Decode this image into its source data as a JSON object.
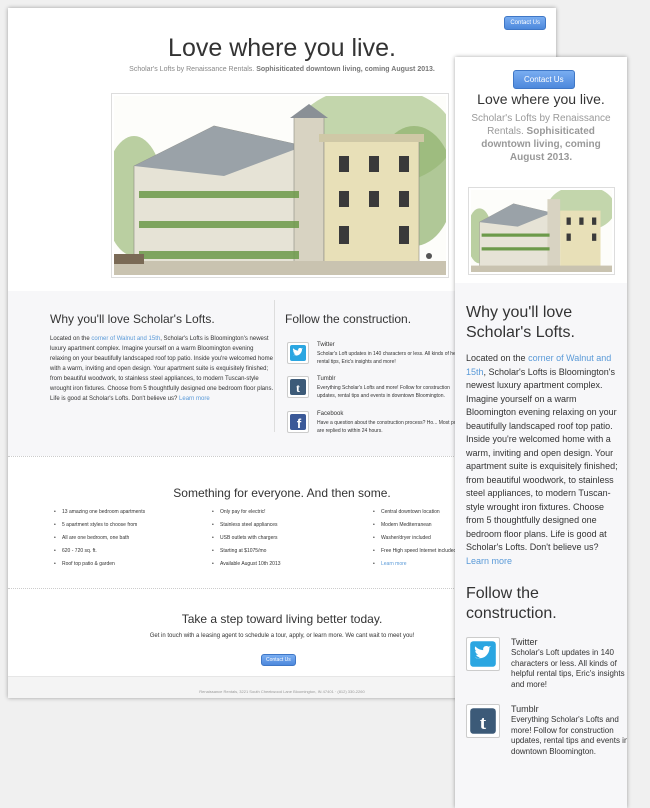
{
  "header": {
    "contact_label": "Contact Us",
    "title": "Love where you live.",
    "subtitle_plain": "Scholar's Lofts by Renaissance Rentals.",
    "subtitle_bold": "Sophisiticated downtown living, coming August 2013."
  },
  "why": {
    "heading_desktop": "Why you'll love Scholar's Lofts.",
    "heading_mobile": "Why you'll love Scholar's Lofts.",
    "lead": "Located on the",
    "link": "corner of Walnut and 15th",
    "body": ", Scholar's Lofts is Bloomington's newest luxury apartment complex. Imagine yourself on a warm Bloomington evening relaxing on your beautifully landscaped roof top patio. Inside you're welcomed home with a warm, inviting and open design. Your apartment suite is exquisitely finished; from beautiful woodwork, to stainless steel appliances, to modern Tuscan-style wrought iron fixtures. Choose from 5 thoughtfully designed one bedroom floor plans. Life is good at Scholar's Lofts. Don't believe us?",
    "more": "Learn more"
  },
  "follow": {
    "heading": "Follow the construction.",
    "items": [
      {
        "icon": "twitter-icon",
        "name": "Twitter",
        "desc": "Scholar's Loft updates in 140 characters or less. All kinds of helpful rental tips, Eric's insights and more!"
      },
      {
        "icon": "tumblr-icon",
        "name": "Tumblr",
        "desc": "Everything Scholar's Lofts and more! Follow for construction updates, rental tips and events in downtown Bloomington."
      },
      {
        "icon": "facebook-icon",
        "name": "Facebook",
        "desc": "Have a question about the construction process? Ho... Most posts are replied to within 24 hours."
      }
    ]
  },
  "features": {
    "heading": "Something for everyone. And then some.",
    "col1": [
      "13 amazing one bedroom apartments",
      "5 apartment styles to choose from",
      "All are one bedroom, one bath",
      "620 - 720 sq. ft.",
      "Roof top patio & garden"
    ],
    "col2": [
      "Only pay for electric!",
      "Stainless steel appliances",
      "USB outlets with chargers",
      "Starting at $1075/mo",
      "Available August 10th 2013"
    ],
    "col3": [
      "Central downtown location",
      "Modern Mediterranean",
      "Washer/dryer included",
      "Free High speed Internet included"
    ],
    "col3_more": "Learn more"
  },
  "cta": {
    "heading": "Take a step toward living better today.",
    "text": "Get in touch with a leasing agent to schedule a tour, apply, or learn more. We cant wait to meet you!",
    "button": "Contact Us"
  },
  "footer": {
    "text": "Renaissance Rentals, 3221 South Cheekwood Lane Bloomington, IN 47401 · (812) 330-2260"
  },
  "colors": {
    "accent": "#4d88dc",
    "link": "#5a9ad8",
    "twitter": "#2ba6e1",
    "tumblr": "#3c5a78",
    "facebook": "#3b5998"
  }
}
